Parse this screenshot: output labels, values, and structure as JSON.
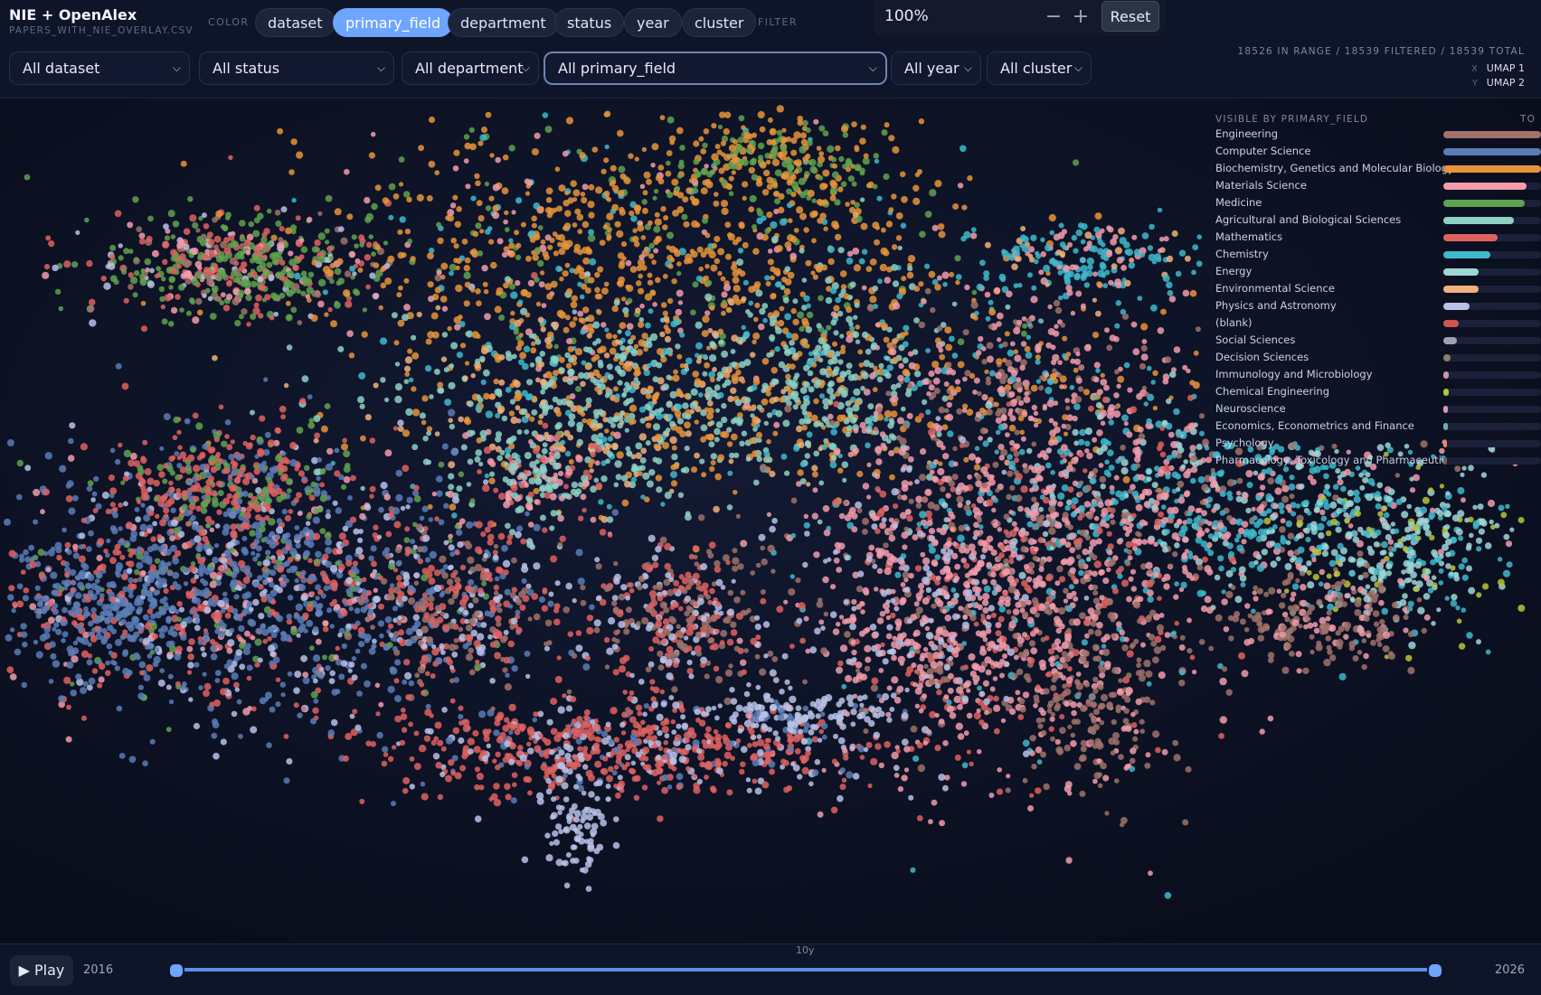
{
  "app": {
    "title": "NIE + OpenAlex",
    "subtitle": "PAPERS_WITH_NIE_OVERLAY.CSV"
  },
  "color_by": {
    "label": "COLOR",
    "options": [
      "dataset",
      "primary_field",
      "department",
      "status",
      "year",
      "cluster"
    ],
    "selected": "primary_field"
  },
  "filter_label": "FILTER",
  "zoom": {
    "value": "100%",
    "minus": "−",
    "plus": "+",
    "reset": "Reset"
  },
  "filters": {
    "dataset": "All dataset",
    "status": "All status",
    "department": "All department",
    "primary_field": "All primary_field",
    "year": "All year",
    "cluster": "All cluster"
  },
  "counts": "18526 IN RANGE / 18539 FILTERED / 18539 TOTAL",
  "axes": {
    "x_key": "X",
    "x": "UMAP 1",
    "y_key": "Y",
    "y": "UMAP 2"
  },
  "legend": {
    "title": "VISIBLE BY PRIMARY_FIELD",
    "column": "TO",
    "items": [
      {
        "label": "Engineering",
        "color": "#a0726a",
        "share": 1.0
      },
      {
        "label": "Computer Science",
        "color": "#5b7db6",
        "share": 1.0
      },
      {
        "label": "Biochemistry, Genetics and Molecular Biology",
        "color": "#e8943a",
        "share": 1.0
      },
      {
        "label": "Materials Science",
        "color": "#f29cac",
        "share": 0.85
      },
      {
        "label": "Medicine",
        "color": "#5fa24f",
        "share": 0.83
      },
      {
        "label": "Agricultural and Biological Sciences",
        "color": "#8ed1c4",
        "share": 0.72
      },
      {
        "label": "Mathematics",
        "color": "#e06260",
        "share": 0.56
      },
      {
        "label": "Chemistry",
        "color": "#3eb9cd",
        "share": 0.48
      },
      {
        "label": "Energy",
        "color": "#9ed6d6",
        "share": 0.36
      },
      {
        "label": "Environmental Science",
        "color": "#f2b07a",
        "share": 0.36
      },
      {
        "label": "Physics and Astronomy",
        "color": "#b9c2e6",
        "share": 0.27
      },
      {
        "label": "(blank)",
        "color": "#d1544f",
        "share": 0.16
      },
      {
        "label": "Social Sciences",
        "color": "#9aa3b5",
        "share": 0.14
      },
      {
        "label": "Decision Sciences",
        "color": "#8a7d6a",
        "share": 0.07
      },
      {
        "label": "Immunology and Microbiology",
        "color": "#c79aa6",
        "share": 0.06
      },
      {
        "label": "Chemical Engineering",
        "color": "#b8c436",
        "share": 0.06
      },
      {
        "label": "Neuroscience",
        "color": "#d59ab8",
        "share": 0.05
      },
      {
        "label": "Economics, Econometrics and Finance",
        "color": "#6bb0a6",
        "share": 0.05
      },
      {
        "label": "Psychology",
        "color": "#e38a6b",
        "share": 0.04
      },
      {
        "label": "Pharmacology, Toxicology and Pharmaceutics",
        "color": "#7c5a57",
        "share": 0.03
      }
    ]
  },
  "timeline": {
    "play": "▶ Play",
    "start_year": "2016",
    "end_year": "2026",
    "range_label": "10y",
    "range_start_fraction": 0.0,
    "range_end_fraction": 1.0
  }
}
